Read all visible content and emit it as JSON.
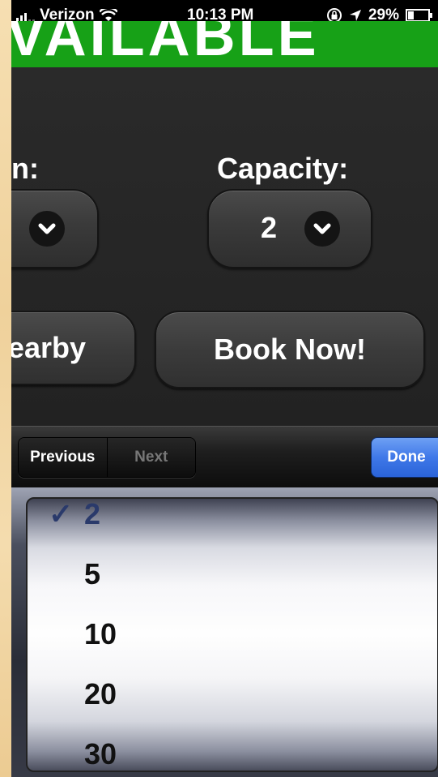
{
  "status_bar": {
    "carrier": "Verizon",
    "time": "10:13 PM",
    "battery": "29%",
    "battery_level": 0.29,
    "icons": [
      "signal-icon",
      "wifi-icon",
      "rotation-lock-icon",
      "location-icon",
      "battery-icon"
    ]
  },
  "header": {
    "title": "VAILABLE",
    "color": "#17a117"
  },
  "form": {
    "left_label": "n:",
    "capacity_label": "Capacity:",
    "capacity_value": "2",
    "nearby_label": "earby",
    "book_now_label": "Book Now!"
  },
  "toolbar": {
    "previous_label": "Previous",
    "next_label": "Next",
    "done_label": "Done",
    "done_color": "#3f78e8"
  },
  "picker": {
    "options": [
      "2",
      "5",
      "10",
      "20",
      "30"
    ],
    "selected": "2",
    "check_symbol": "✓"
  }
}
